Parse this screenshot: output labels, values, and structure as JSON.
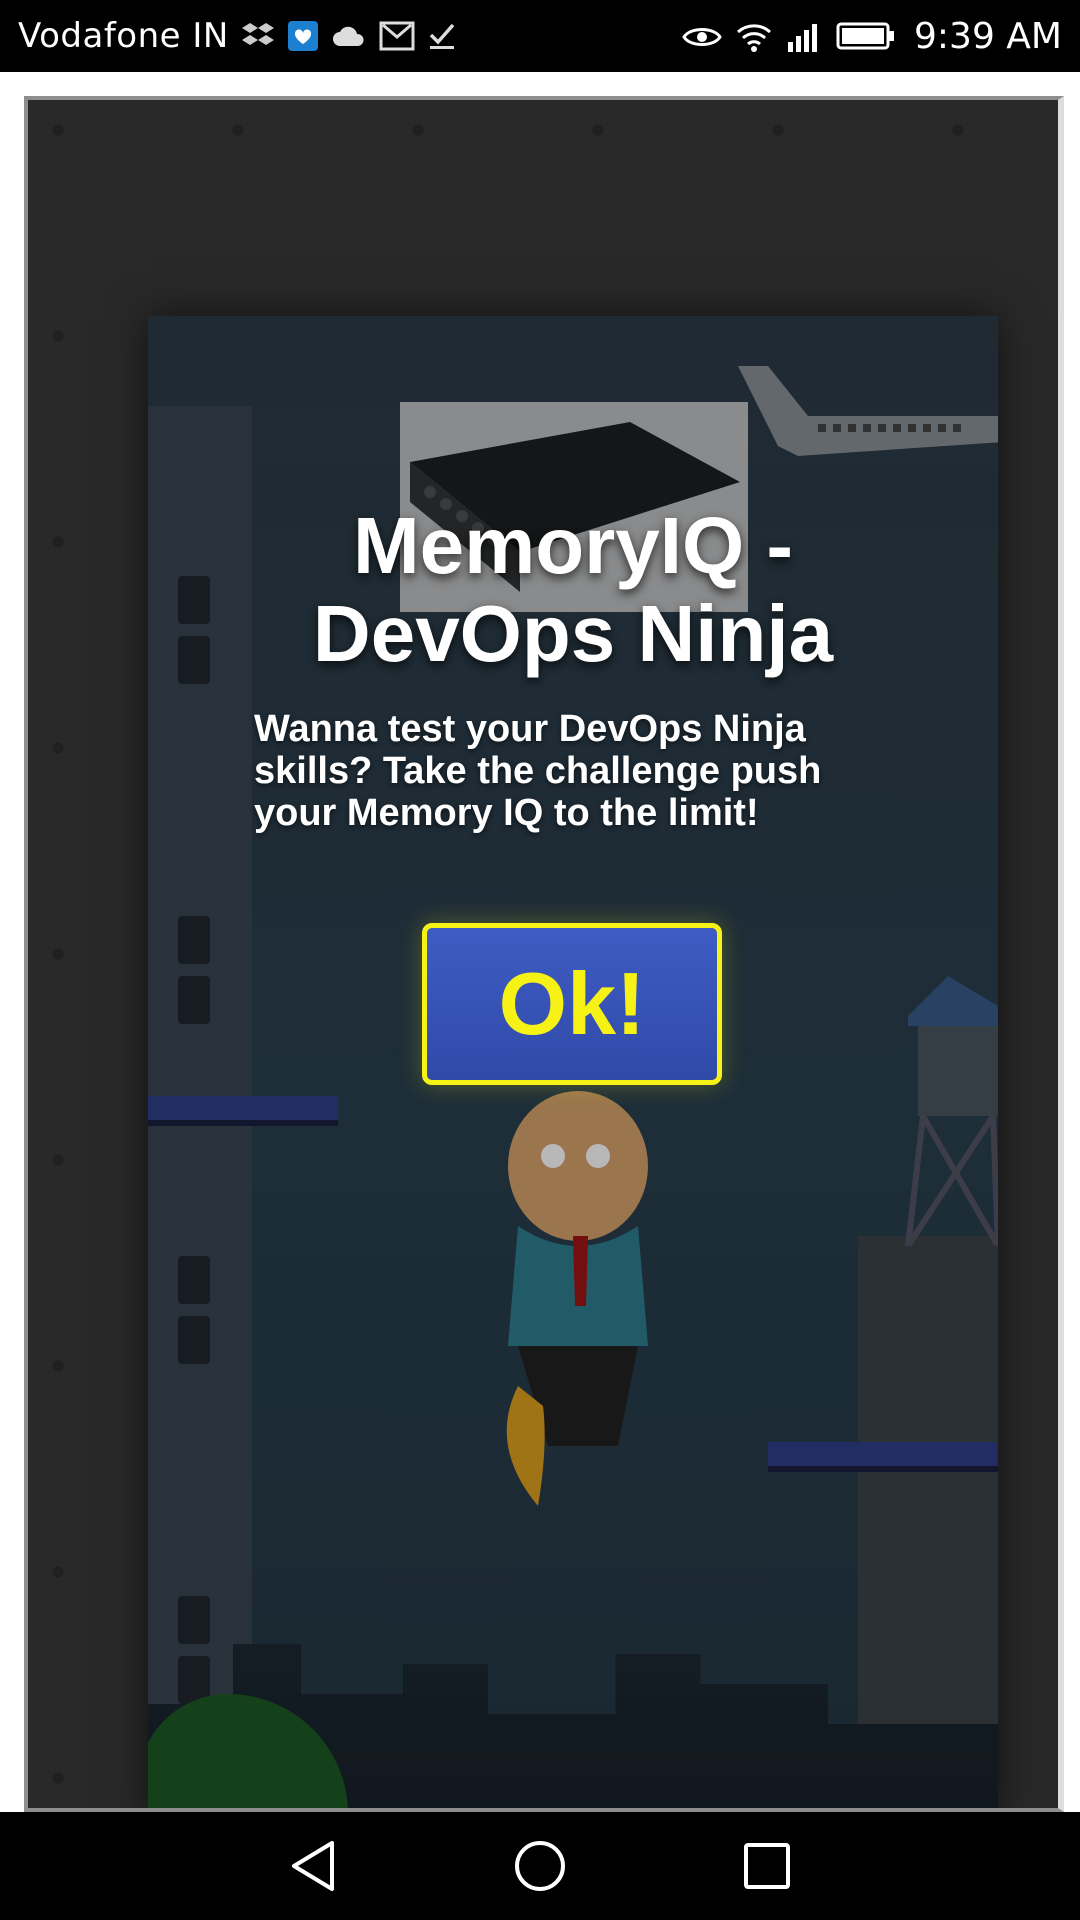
{
  "status_bar": {
    "carrier": "Vodafone IN",
    "time": "9:39 AM",
    "icons_left": [
      "dropbox-icon",
      "health-icon",
      "cloud-icon",
      "mail-icon",
      "check-icon"
    ],
    "icons_right": [
      "eye-icon",
      "wifi-icon",
      "signal-icon",
      "battery-icon"
    ]
  },
  "dialog": {
    "title_line1": "MemoryIQ -",
    "title_line2": "DevOps Ninja",
    "description": "Wanna test your DevOps Ninja skills? Take the challenge push your Memory IQ to the limit!",
    "ok_label": "Ok!"
  },
  "nav_bar": {
    "buttons": [
      "back-icon",
      "home-icon",
      "recents-icon"
    ]
  },
  "colors": {
    "accent_yellow": "#f7f216",
    "button_blue": "#3752b8",
    "scene_bg": "#2d3b47"
  }
}
